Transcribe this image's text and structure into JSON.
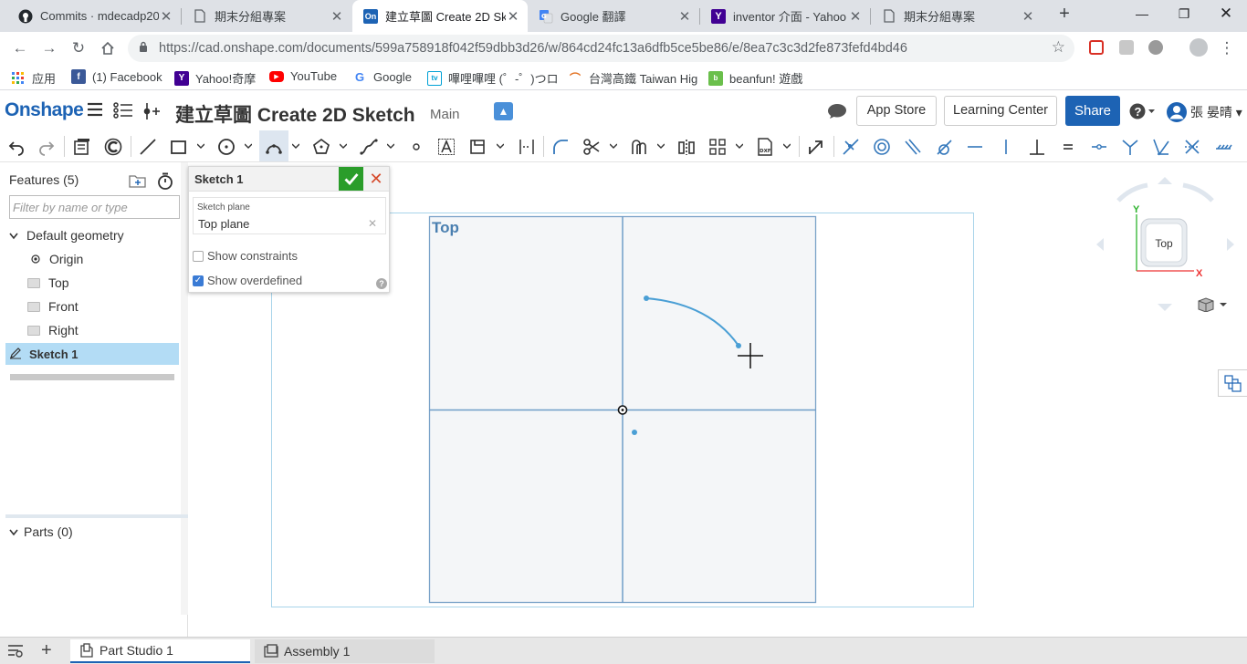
{
  "browser": {
    "tabs": [
      {
        "title": "Commits · mdecadp20",
        "icon": "github-icon"
      },
      {
        "title": "期末分組專案",
        "icon": "page-icon"
      },
      {
        "title": "建立草圖 Create 2D Sk",
        "icon": "onshape-icon"
      },
      {
        "title": "Google 翻譯",
        "icon": "google-translate-icon"
      },
      {
        "title": "inventor 介面 - Yahoo",
        "icon": "yahoo-icon"
      },
      {
        "title": "期末分組專案",
        "icon": "page-icon"
      }
    ],
    "url": "https://cad.onshape.com/documents/599a758918f042f59dbb3d26/w/864cd24fc13a6dfb5ce5be86/e/8ea7c3c3d2fe873fefd4bd46",
    "bookmarks": [
      {
        "label": "应用",
        "icon": "apps-icon",
        "color": "#4285f4"
      },
      {
        "label": "(1) Facebook",
        "icon": "facebook-icon",
        "color": "#3b5998"
      },
      {
        "label": "Yahoo!奇摩",
        "icon": "yahoo-icon",
        "color": "#410093"
      },
      {
        "label": "YouTube",
        "icon": "youtube-icon",
        "color": "#ff0000"
      },
      {
        "label": "Google",
        "icon": "google-icon",
        "color": "#4285f4"
      },
      {
        "label": "嗶哩嗶哩 (゜-゜)つロ",
        "icon": "bilibili-icon",
        "color": "#00a1d6"
      },
      {
        "label": "台灣高鐵 Taiwan Hig",
        "icon": "thsr-icon",
        "color": "#e37222"
      },
      {
        "label": "beanfun! 遊戲",
        "icon": "beanfun-icon",
        "color": "#6abf4b"
      }
    ]
  },
  "header": {
    "logo": "Onshape",
    "doc_title": "建立草圖 Create 2D Sketch",
    "branch": "Main",
    "app_store": "App Store",
    "learning_center": "Learning Center",
    "share": "Share",
    "help": "?",
    "user": "張 晏晴"
  },
  "features": {
    "title": "Features (5)",
    "filter_placeholder": "Filter by name or type",
    "default_geometry": "Default geometry",
    "items": [
      {
        "label": "Origin",
        "icon": "origin-icon"
      },
      {
        "label": "Top",
        "icon": "plane-icon"
      },
      {
        "label": "Front",
        "icon": "plane-icon"
      },
      {
        "label": "Right",
        "icon": "plane-icon"
      }
    ],
    "sketch": "Sketch 1",
    "parts": "Parts (0)"
  },
  "sketch_dialog": {
    "name": "Sketch 1",
    "plane_label": "Sketch plane",
    "plane_value": "Top plane",
    "show_constraints": "Show constraints",
    "show_constraints_checked": false,
    "show_overdefined": "Show overdefined",
    "show_overdefined_checked": true
  },
  "canvas": {
    "plane_label": "Top"
  },
  "viewcube": {
    "face": "Top",
    "axis_x": "X",
    "axis_y": "Y"
  },
  "bottom_tabs": [
    {
      "label": "Part Studio 1",
      "active": true
    },
    {
      "label": "Assembly 1",
      "active": false
    }
  ],
  "colors": {
    "brand": "#1d63b4",
    "ok": "#2a9d2a",
    "cancel": "#d64a2b",
    "sketch_geom": "#4a9fd5",
    "grid_line": "#6e9dc8"
  }
}
